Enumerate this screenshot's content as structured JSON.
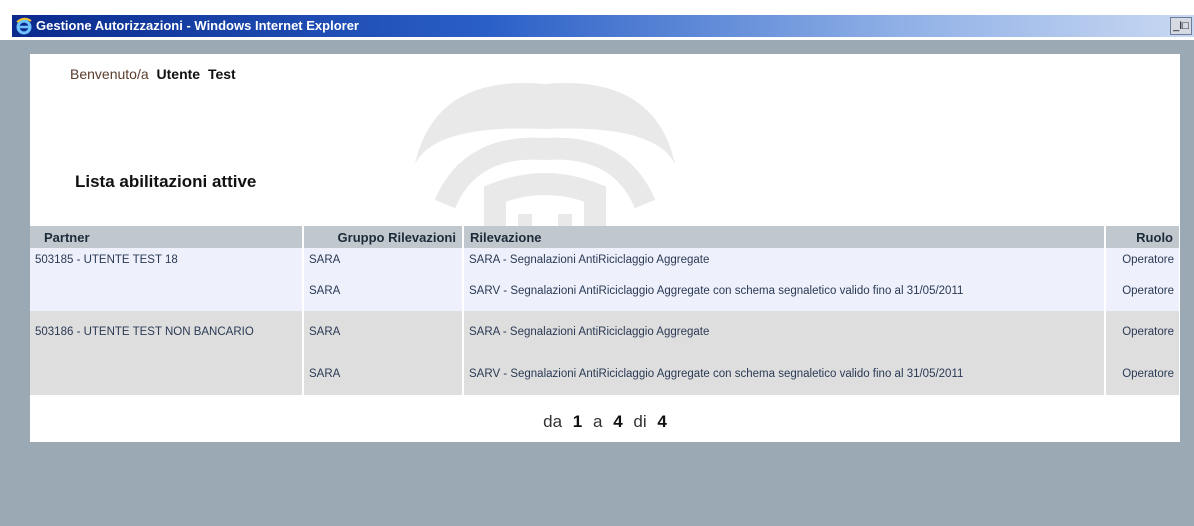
{
  "window": {
    "title": "Gestione Autorizzazioni - Windows Internet Explorer",
    "controls_label": "_I□"
  },
  "welcome": {
    "prefix": "Benvenuto/a",
    "first_name": "Utente",
    "last_name": "Test"
  },
  "list_title": "Lista abilitazioni attive",
  "table": {
    "headers": {
      "partner": "Partner",
      "gruppo": "Gruppo Rilevazioni",
      "rilevazione": "Rilevazione",
      "ruolo": "Ruolo"
    },
    "rows": [
      {
        "partner": "503185 - UTENTE TEST 18",
        "gruppo": "SARA",
        "rilevazione": "SARA - Segnalazioni AntiRiciclaggio Aggregate",
        "ruolo": "Operatore"
      },
      {
        "partner": "",
        "gruppo": "SARA",
        "rilevazione": "SARV - Segnalazioni AntiRiciclaggio Aggregate con schema segnaletico valido fino al 31/05/2011",
        "ruolo": "Operatore"
      },
      {
        "partner": "503186 - UTENTE TEST NON BANCARIO",
        "gruppo": "SARA",
        "rilevazione": "SARA - Segnalazioni AntiRiciclaggio Aggregate",
        "ruolo": "Operatore"
      },
      {
        "partner": "",
        "gruppo": "SARA",
        "rilevazione": "SARV - Segnalazioni AntiRiciclaggio Aggregate con schema segnaletico valido fino al 31/05/2011",
        "ruolo": "Operatore"
      }
    ]
  },
  "pager": {
    "da": "da",
    "from": "1",
    "a": "a",
    "to": "4",
    "di": "di",
    "total": "4"
  },
  "colors": {
    "titlebar_dark": "#0a2a8c",
    "background": "#9ba9b4",
    "header_bg": "#c0c8ce",
    "row_light": "#eef0fb",
    "row_gray": "#dedede"
  },
  "icons": {
    "browser": "internet-explorer-icon",
    "watermark": "emblem-watermark"
  }
}
